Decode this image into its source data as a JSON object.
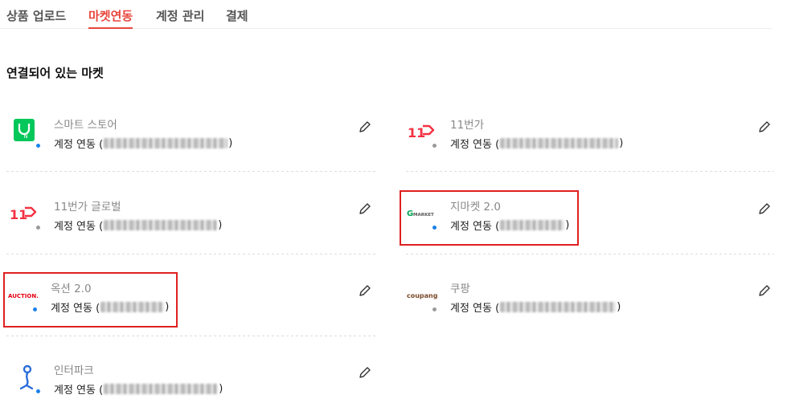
{
  "tabs": [
    {
      "label": "상품 업로드",
      "active": false
    },
    {
      "label": "마켓연동",
      "active": true
    },
    {
      "label": "계정 관리",
      "active": false
    },
    {
      "label": "결제",
      "active": false
    }
  ],
  "section_title": "연결되어 있는 마켓",
  "account_prefix": "계정 연동 (",
  "account_suffix": ")",
  "markets": [
    {
      "name": "스마트 스토어",
      "logo_icon": "naver-smartstore-logo",
      "logo_text": "N",
      "connected": true
    },
    {
      "name": "11번가",
      "logo_icon": "11st-logo",
      "logo_text": "11",
      "connected": false
    },
    {
      "name": "11번가 글로벌",
      "logo_icon": "11st-global-logo",
      "logo_text": "11",
      "connected": false
    },
    {
      "name": "지마켓 2.0",
      "logo_icon": "gmarket-logo",
      "logo_text": "MARKET",
      "connected": true
    },
    {
      "name": "옥션 2.0",
      "logo_icon": "auction-logo",
      "logo_text": "AUCTION.",
      "connected": true
    },
    {
      "name": "쿠팡",
      "logo_icon": "coupang-logo",
      "logo_text": "coupang",
      "connected": false
    },
    {
      "name": "인터파크",
      "logo_icon": "interpark-logo",
      "logo_text": "",
      "connected": true
    }
  ],
  "colors": {
    "accent": "#e8473c",
    "connected_dot": "#1a82e8",
    "disconnected_dot": "#9a9a9a",
    "highlight_box": "#e02020",
    "naver_green": "#03c75a",
    "gmarket_green": "#00a652",
    "auction_red": "#e60012",
    "interpark_blue": "#2b6cd9"
  }
}
